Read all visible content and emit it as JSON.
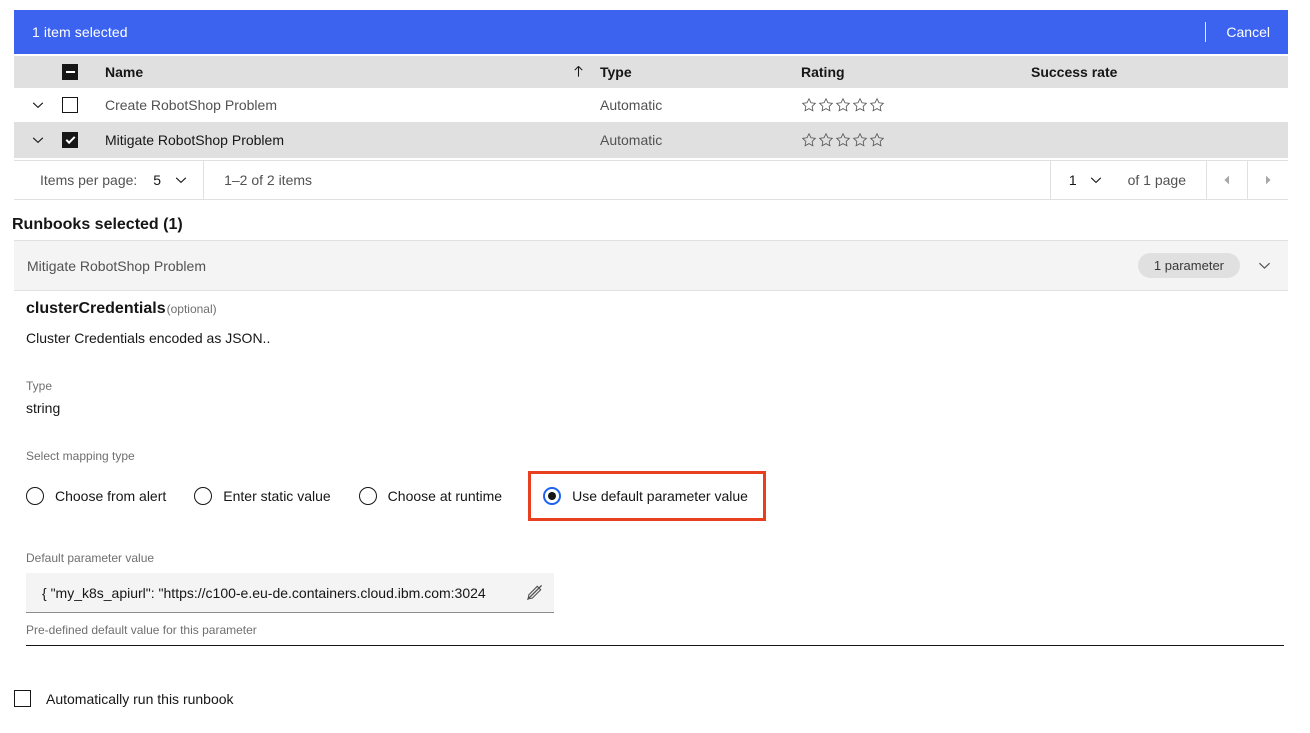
{
  "banner": {
    "title": "1 item selected",
    "cancel_label": "Cancel"
  },
  "table": {
    "columns": [
      "Name",
      "Type",
      "Rating",
      "Success rate"
    ],
    "sort_icon": "sort-ascending-icon",
    "header_checkbox_state": "indeterminate",
    "rows": [
      {
        "name": "Create RobotShop Problem",
        "type": "Automatic",
        "rating": 0,
        "rating_max": 5,
        "success_rate": "",
        "selected": false
      },
      {
        "name": "Mitigate RobotShop Problem",
        "type": "Automatic",
        "rating": 0,
        "rating_max": 5,
        "success_rate": "",
        "selected": true
      }
    ]
  },
  "pagination": {
    "items_per_page_label": "Items per page:",
    "items_per_page_value": "5",
    "range_text": "1–2 of 2 items",
    "page_value": "1",
    "page_of_text": "of 1 page",
    "prev_icon": "caret-left-icon",
    "next_icon": "caret-right-icon"
  },
  "selected_section": {
    "title": "Runbooks selected (1)",
    "accordion_title": "Mitigate RobotShop Problem",
    "tag_label": "1 parameter",
    "chevron_icon": "chevron-down-icon"
  },
  "parameter": {
    "name": "clusterCredentials",
    "optional_suffix": "(optional)",
    "description": "Cluster Credentials encoded as JSON..",
    "type_label": "Type",
    "type_value": "string",
    "mapping_label": "Select mapping type",
    "mapping_options": [
      {
        "label": "Choose from alert",
        "selected": false
      },
      {
        "label": "Enter static value",
        "selected": false
      },
      {
        "label": "Choose at runtime",
        "selected": false
      },
      {
        "label": "Use default parameter value",
        "selected": true
      }
    ],
    "default_value_label": "Default parameter value",
    "default_value": "{ \"my_k8s_apiurl\": \"https://c100-e.eu-de.containers.cloud.ibm.com:3024",
    "default_value_icon": "edit-off-icon",
    "helper_text": "Pre-defined default value for this parameter"
  },
  "footer": {
    "auto_run_label": "Automatically run this runbook",
    "auto_run_checked": false
  },
  "colors": {
    "banner_blue": "#3b63f0",
    "highlight_red": "#e8401f",
    "radio_blue": "#1f62f0",
    "header_grey": "#e0e0e0",
    "panel_grey": "#f4f4f4"
  }
}
